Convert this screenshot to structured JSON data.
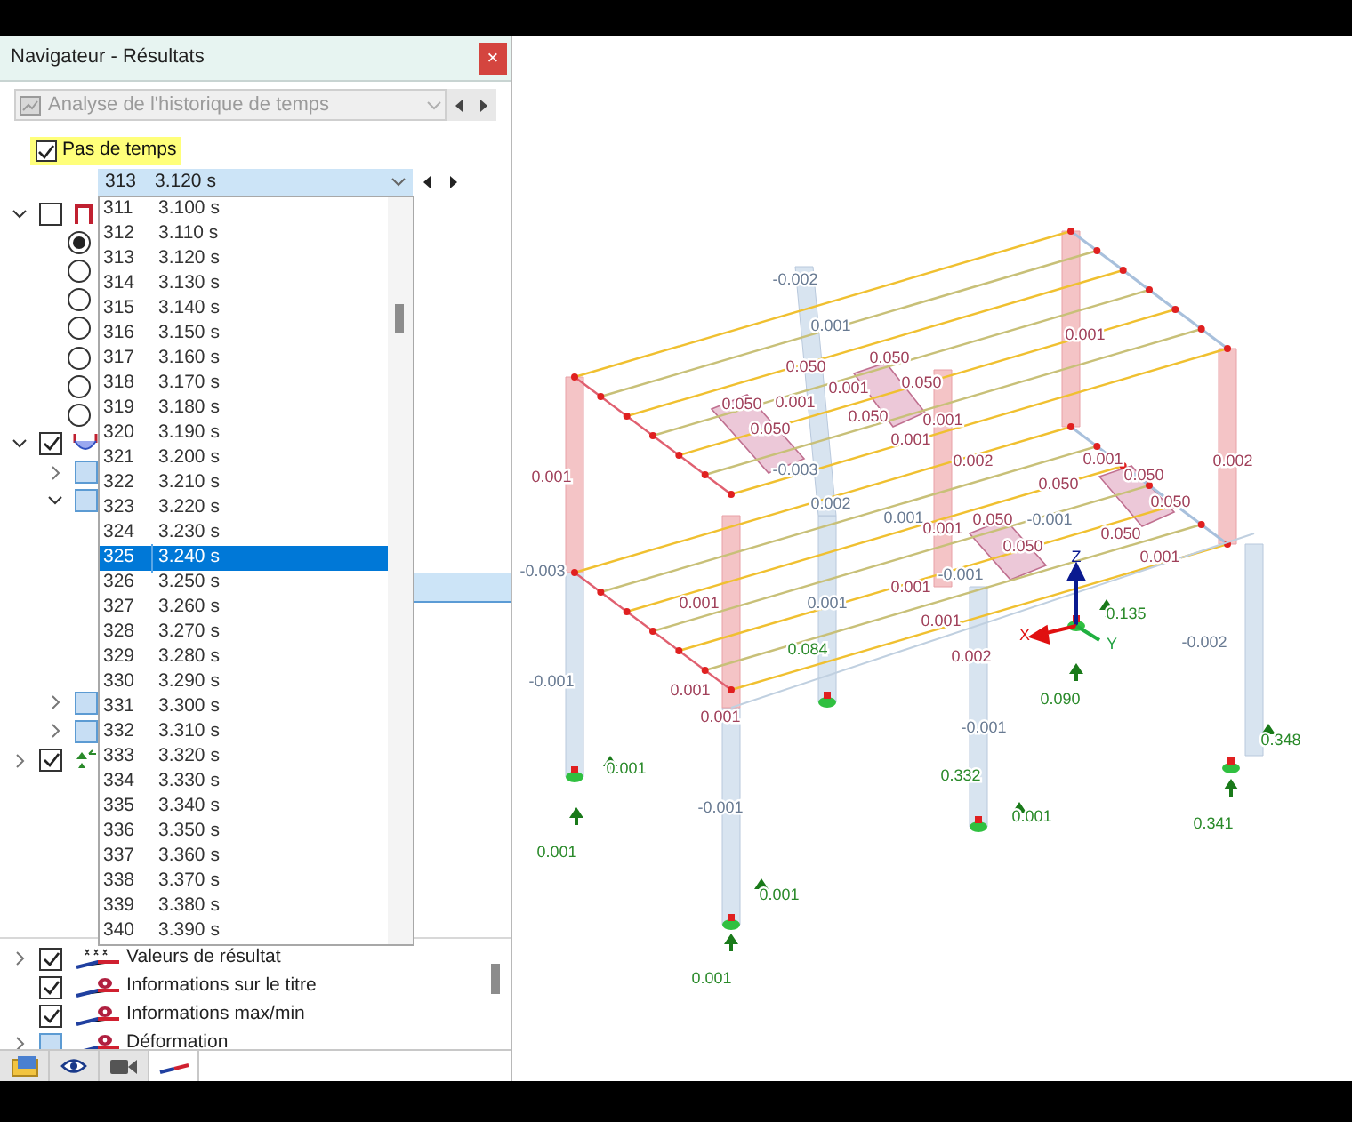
{
  "window": {
    "title": "Navigateur - Résultats",
    "close": "×"
  },
  "analysis_combo": {
    "value": "Analyse de l'historique de temps",
    "disabled": true
  },
  "time_steps_toggle": {
    "label": "Pas de temps",
    "checked": true
  },
  "time_step_combo": {
    "number": "313",
    "value": "3.120 s"
  },
  "time_step_list": [
    {
      "number": "311",
      "time": "3.100 s",
      "selected": false
    },
    {
      "number": "312",
      "time": "3.110 s",
      "selected": false
    },
    {
      "number": "313",
      "time": "3.120 s",
      "selected": false
    },
    {
      "number": "314",
      "time": "3.130 s",
      "selected": false
    },
    {
      "number": "315",
      "time": "3.140 s",
      "selected": false
    },
    {
      "number": "316",
      "time": "3.150 s",
      "selected": false
    },
    {
      "number": "317",
      "time": "3.160 s",
      "selected": false
    },
    {
      "number": "318",
      "time": "3.170 s",
      "selected": false
    },
    {
      "number": "319",
      "time": "3.180 s",
      "selected": false
    },
    {
      "number": "320",
      "time": "3.190 s",
      "selected": false
    },
    {
      "number": "321",
      "time": "3.200 s",
      "selected": false
    },
    {
      "number": "322",
      "time": "3.210 s",
      "selected": false
    },
    {
      "number": "323",
      "time": "3.220 s",
      "selected": false
    },
    {
      "number": "324",
      "time": "3.230 s",
      "selected": false
    },
    {
      "number": "325",
      "time": "3.240 s",
      "selected": true
    },
    {
      "number": "326",
      "time": "3.250 s",
      "selected": false
    },
    {
      "number": "327",
      "time": "3.260 s",
      "selected": false
    },
    {
      "number": "328",
      "time": "3.270 s",
      "selected": false
    },
    {
      "number": "329",
      "time": "3.280 s",
      "selected": false
    },
    {
      "number": "330",
      "time": "3.290 s",
      "selected": false
    },
    {
      "number": "331",
      "time": "3.300 s",
      "selected": false
    },
    {
      "number": "332",
      "time": "3.310 s",
      "selected": false
    },
    {
      "number": "333",
      "time": "3.320 s",
      "selected": false
    },
    {
      "number": "334",
      "time": "3.330 s",
      "selected": false
    },
    {
      "number": "335",
      "time": "3.340 s",
      "selected": false
    },
    {
      "number": "336",
      "time": "3.350 s",
      "selected": false
    },
    {
      "number": "337",
      "time": "3.360 s",
      "selected": false
    },
    {
      "number": "338",
      "time": "3.370 s",
      "selected": false
    },
    {
      "number": "339",
      "time": "3.380 s",
      "selected": false
    },
    {
      "number": "340",
      "time": "3.390 s",
      "selected": false
    }
  ],
  "tree": [
    {
      "kind": "members",
      "checked": false,
      "expanded": true,
      "children": [
        {
          "kind": "radio",
          "selected": true
        },
        {
          "kind": "radio",
          "selected": false
        },
        {
          "kind": "radio",
          "selected": false
        },
        {
          "kind": "radio",
          "selected": false
        },
        {
          "kind": "radio",
          "selected": false
        },
        {
          "kind": "radio",
          "selected": false
        },
        {
          "kind": "radio",
          "selected": false
        }
      ]
    },
    {
      "kind": "deformation",
      "checked": true,
      "expanded": true,
      "children": [
        {
          "kind": "option",
          "checked": false,
          "partial": true,
          "expanded": false
        },
        {
          "kind": "option",
          "checked": false,
          "partial": true,
          "expanded": true
        },
        {
          "kind": "covered",
          "selected": true
        },
        {
          "kind": "option",
          "checked": false,
          "partial": true,
          "expanded": false
        },
        {
          "kind": "option",
          "checked": false,
          "partial": true,
          "expanded": false
        }
      ]
    },
    {
      "kind": "supports",
      "checked": true,
      "expanded": false
    }
  ],
  "display_items": [
    {
      "label": "Valeurs de résultat",
      "checked": true,
      "expandable": true,
      "kind": "values"
    },
    {
      "label": "Informations sur le titre",
      "checked": true,
      "expandable": false,
      "kind": "info"
    },
    {
      "label": "Informations max/min",
      "checked": true,
      "expandable": false,
      "kind": "info"
    },
    {
      "label": "Déformation",
      "checked": false,
      "expandable": true,
      "kind": "info"
    }
  ],
  "bottom_tabs": [
    {
      "kind": "navigator",
      "selected": false
    },
    {
      "kind": "view",
      "selected": false
    },
    {
      "kind": "camera",
      "selected": false
    },
    {
      "kind": "results",
      "selected": true
    }
  ],
  "model": {
    "axes": [
      "Z",
      "X",
      "Y"
    ],
    "values": [
      {
        "text": "-0.002",
        "color": "#687a92"
      },
      {
        "text": "0.001",
        "color": "#687a92"
      },
      {
        "text": "0.001",
        "color": "#a0405a"
      },
      {
        "text": "0.050",
        "color": "#a0405a"
      },
      {
        "text": "0.050",
        "color": "#a0405a"
      },
      {
        "text": "0.050",
        "color": "#a0405a"
      },
      {
        "text": "0.001",
        "color": "#a0405a"
      },
      {
        "text": "0.050",
        "color": "#a0405a"
      },
      {
        "text": "0.001",
        "color": "#a0405a"
      },
      {
        "text": "0.050",
        "color": "#a0405a"
      },
      {
        "text": "0.001",
        "color": "#a0405a"
      },
      {
        "text": "0.050",
        "color": "#a0405a"
      },
      {
        "text": "0.001",
        "color": "#a0405a"
      },
      {
        "text": "0.002",
        "color": "#a0405a"
      },
      {
        "text": "0.001",
        "color": "#a0405a"
      },
      {
        "text": "0.002",
        "color": "#a0405a"
      },
      {
        "text": "-0.003",
        "color": "#687a92"
      },
      {
        "text": "0.001",
        "color": "#a0405a"
      },
      {
        "text": "0.050",
        "color": "#a0405a"
      },
      {
        "text": "0.050",
        "color": "#a0405a"
      },
      {
        "text": "0.050",
        "color": "#a0405a"
      },
      {
        "text": "0.002",
        "color": "#687a92"
      },
      {
        "text": "0.001",
        "color": "#687a92"
      },
      {
        "text": "0.001",
        "color": "#a0405a"
      },
      {
        "text": "0.050",
        "color": "#a0405a"
      },
      {
        "text": "-0.001",
        "color": "#687a92"
      },
      {
        "text": "0.050",
        "color": "#a0405a"
      },
      {
        "text": "0.050",
        "color": "#a0405a"
      },
      {
        "text": "0.001",
        "color": "#a0405a"
      },
      {
        "text": "-0.003",
        "color": "#687a92"
      },
      {
        "text": "-0.001",
        "color": "#687a92"
      },
      {
        "text": "0.001",
        "color": "#a0405a"
      },
      {
        "text": "0.001",
        "color": "#a0405a"
      },
      {
        "text": "0.001",
        "color": "#687a92"
      },
      {
        "text": "0.001",
        "color": "#a0405a"
      },
      {
        "text": "0.084",
        "color": "#2a8a2a"
      },
      {
        "text": "0.002",
        "color": "#a0405a"
      },
      {
        "text": "-0.001",
        "color": "#687a92"
      },
      {
        "text": "0.001",
        "color": "#a0405a"
      },
      {
        "text": "0.001",
        "color": "#a0405a"
      },
      {
        "text": "0.135",
        "color": "#2a8a2a"
      },
      {
        "text": "0.090",
        "color": "#2a8a2a"
      },
      {
        "text": "-0.002",
        "color": "#687a92"
      },
      {
        "text": "-0.001",
        "color": "#687a92"
      },
      {
        "text": "0.348",
        "color": "#2a8a2a"
      },
      {
        "text": "0.001",
        "color": "#2a8a2a"
      },
      {
        "text": "0.332",
        "color": "#2a8a2a"
      },
      {
        "text": "0.001",
        "color": "#2a8a2a"
      },
      {
        "text": "-0.001",
        "color": "#687a92"
      },
      {
        "text": "0.001",
        "color": "#2a8a2a"
      },
      {
        "text": "0.341",
        "color": "#2a8a2a"
      },
      {
        "text": "0.001",
        "color": "#2a8a2a"
      },
      {
        "text": "0.001",
        "color": "#2a8a2a"
      }
    ]
  }
}
